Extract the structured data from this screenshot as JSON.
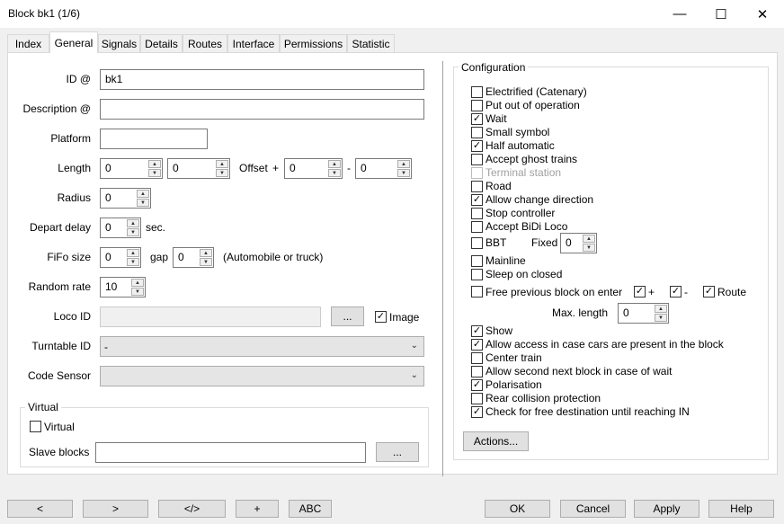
{
  "window": {
    "title": "Block bk1 (1/6)",
    "minimize": "—",
    "maximize": "☐",
    "close": "✕"
  },
  "tabs": [
    "Index",
    "General",
    "Signals",
    "Details",
    "Routes",
    "Interface",
    "Permissions",
    "Statistic"
  ],
  "active_tab": "General",
  "general": {
    "id_label": "ID @",
    "id_value": "bk1",
    "description_label": "Description @",
    "description_value": "",
    "platform_label": "Platform",
    "platform_value": "",
    "length_label": "Length",
    "length_value1": "0",
    "length_value2": "0",
    "offset_label": "Offset",
    "offset_plus": "+",
    "offset_value1": "0",
    "offset_minus": "-",
    "offset_value2": "0",
    "radius_label": "Radius",
    "radius_value": "0",
    "depart_delay_label": "Depart delay",
    "depart_delay_value": "0",
    "depart_delay_unit": "sec.",
    "fifo_size_label": "FiFo size",
    "fifo_size_value": "0",
    "gap_label": "gap",
    "gap_value": "0",
    "fifo_note": "(Automobile or truck)",
    "random_rate_label": "Random rate",
    "random_rate_value": "10",
    "loco_id_label": "Loco ID",
    "loco_id_value": "",
    "loco_browse": "...",
    "image_label": "Image",
    "image_checked": true,
    "turntable_label": "Turntable ID",
    "turntable_value": "-",
    "code_sensor_label": "Code Sensor",
    "code_sensor_value": ""
  },
  "virtual": {
    "group_label": "Virtual",
    "checkbox_label": "Virtual",
    "checked": false,
    "slave_blocks_label": "Slave blocks",
    "slave_blocks_value": "",
    "browse": "..."
  },
  "configuration": {
    "group_label": "Configuration",
    "items": [
      {
        "label": "Electrified (Catenary)",
        "checked": false,
        "disabled": false
      },
      {
        "label": "Put out of operation",
        "checked": false,
        "disabled": false
      },
      {
        "label": "Wait",
        "checked": true,
        "disabled": false
      },
      {
        "label": "Small symbol",
        "checked": false,
        "disabled": false
      },
      {
        "label": "Half automatic",
        "checked": true,
        "disabled": false
      },
      {
        "label": "Accept ghost trains",
        "checked": false,
        "disabled": false
      },
      {
        "label": "Terminal station",
        "checked": false,
        "disabled": true
      },
      {
        "label": "Road",
        "checked": false,
        "disabled": false
      },
      {
        "label": "Allow change direction",
        "checked": true,
        "disabled": false
      },
      {
        "label": "Stop controller",
        "checked": false,
        "disabled": false
      },
      {
        "label": "Accept BiDi Loco",
        "checked": false,
        "disabled": false
      }
    ],
    "bbt": {
      "label": "BBT",
      "checked": false,
      "fixed_label": "Fixed",
      "fixed_value": "0"
    },
    "items2": [
      {
        "label": "Mainline",
        "checked": false
      },
      {
        "label": "Sleep on closed",
        "checked": false
      }
    ],
    "free_prev": {
      "label": "Free previous block on enter",
      "checked": false,
      "plus_label": "+",
      "plus_checked": true,
      "minus_label": "-",
      "minus_checked": true,
      "route_label": "Route",
      "route_checked": true
    },
    "max_length_label": "Max. length",
    "max_length_value": "0",
    "items3": [
      {
        "label": "Show",
        "checked": true
      },
      {
        "label": "Allow access in case cars are present in the block",
        "checked": true
      },
      {
        "label": "Center train",
        "checked": false
      },
      {
        "label": "Allow second next block in case of wait",
        "checked": false
      },
      {
        "label": "Polarisation",
        "checked": true
      },
      {
        "label": "Rear collision protection",
        "checked": false
      },
      {
        "label": "Check for free destination until reaching IN",
        "checked": true
      }
    ],
    "actions_button": "Actions..."
  },
  "bottom": {
    "prev": "<",
    "next": ">",
    "code": "</>",
    "add": "+",
    "abc": "ABC",
    "ok": "OK",
    "cancel": "Cancel",
    "apply": "Apply",
    "help": "Help"
  },
  "colors": {
    "panel_bg": "#ffffff",
    "window_bg": "#f0f0f0",
    "border": "#7a7a7a"
  }
}
